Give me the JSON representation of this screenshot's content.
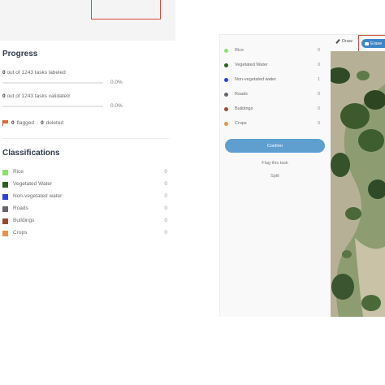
{
  "progress": {
    "title": "Progress",
    "labeled": {
      "count": "0",
      "text": "out of 1243 tasks labeled",
      "percent": "0.0%",
      "fraction": 0
    },
    "validated": {
      "count": "0",
      "text": "out of 1243 tasks validated",
      "percent": "0.0%",
      "fraction": 0
    },
    "flagged_count": "0",
    "flagged_text": "flagged",
    "separator": "·",
    "deleted_count": "0",
    "deleted_text": "deleted"
  },
  "classifications": {
    "title": "Classifications",
    "items": [
      {
        "label": "Rice",
        "count": "0",
        "color": "#8fe06a"
      },
      {
        "label": "Vegetated Water",
        "count": "0",
        "color": "#2f5e1f"
      },
      {
        "label": "Non-vegetated water",
        "count": "0",
        "color": "#2e3fe0"
      },
      {
        "label": "Roads",
        "count": "0",
        "color": "#6b6470"
      },
      {
        "label": "Buildings",
        "count": "0",
        "color": "#9a4a35"
      },
      {
        "label": "Crops",
        "count": "0",
        "color": "#e8924a"
      }
    ]
  },
  "side_panel": {
    "items": [
      {
        "label": "Rice",
        "count": "0",
        "color": "#8fe06a"
      },
      {
        "label": "Vegetated Water",
        "count": "0",
        "color": "#2f5e1f"
      },
      {
        "label": "Non-vegetated water",
        "count": "1",
        "color": "#2e3fe0"
      },
      {
        "label": "Roads",
        "count": "0",
        "color": "#6b6470"
      },
      {
        "label": "Buildings",
        "count": "0",
        "color": "#9a4a35"
      },
      {
        "label": "Crops",
        "count": "0",
        "color": "#e8924a"
      }
    ],
    "confirm_label": "Confirm",
    "flag_label": "Flag this task",
    "split_label": "Split",
    "draw_label": "Draw",
    "erase_label": "Erase",
    "pencil_icon": "pencil-icon",
    "eraser_icon": "eraser-icon"
  },
  "colors": {
    "accent": "#5f9fd0",
    "highlight": "#d0493a"
  }
}
